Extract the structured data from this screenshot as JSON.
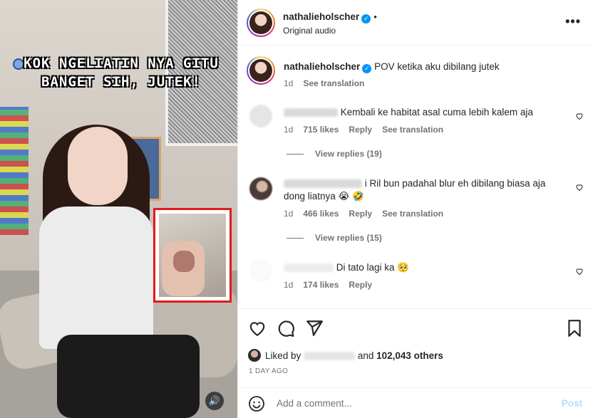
{
  "media": {
    "caption_line1": "KOK NGELIATIN NYA GITU",
    "caption_line2": "BANGET SIH, JUTEK!",
    "volume_icon": "speaker-icon",
    "highlight_color": "#e01b1b"
  },
  "header": {
    "username": "nathalieholscher",
    "verified": true,
    "audio_label": "Original audio",
    "more_icon": "more-horizontal-icon"
  },
  "post_caption": {
    "username": "nathalieholscher",
    "text": "POV ketika aku dibilang jutek",
    "time": "1d",
    "see_translation": "See translation"
  },
  "comments": [
    {
      "text": "Kembali ke habitat asal cuma lebih kalem aja",
      "time": "1d",
      "likes": "715 likes",
      "reply": "Reply",
      "see_translation": "See translation",
      "view_replies": "View replies (19)"
    },
    {
      "username_fragment": "i Ril bun padahal blur eh dibilang biasa aja",
      "text_line2": "dong liatnya 😭 🤣",
      "time": "1d",
      "likes": "466 likes",
      "reply": "Reply",
      "see_translation": "See translation",
      "view_replies": "View replies (15)"
    },
    {
      "text": "Di tato lagi ka 🥺",
      "time": "1d",
      "likes": "174 likes",
      "reply": "Reply"
    }
  ],
  "actions": {
    "liked_by_prefix": "Liked by",
    "liked_by_suffix": "and",
    "others": "102,043 others",
    "time_ago": "1 DAY AGO"
  },
  "add_comment": {
    "placeholder": "Add a comment...",
    "post_label": "Post"
  },
  "colors": {
    "verified_blue": "#0095f6",
    "post_disabled": "#b2dffc",
    "muted_text": "#737373"
  }
}
